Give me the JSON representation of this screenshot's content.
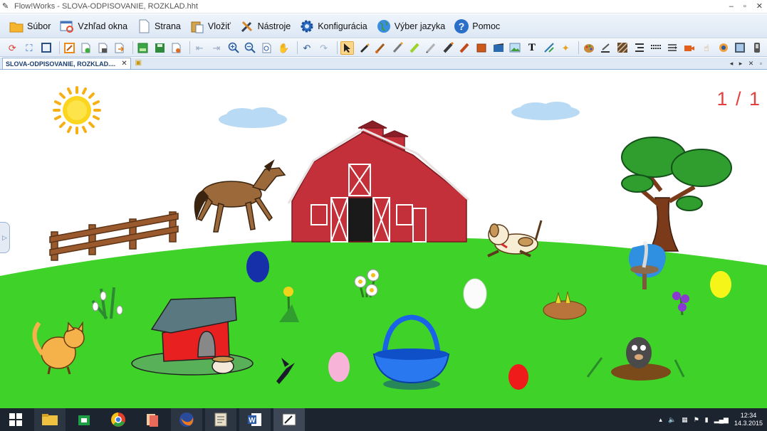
{
  "window": {
    "title": "Flow!Works - SLOVA-ODPISOVANIE, ROZKLAD.hht",
    "controls": [
      "–",
      "▫",
      "✕"
    ]
  },
  "menu": {
    "items": [
      {
        "label": "Súbor",
        "icon": "folder-icon"
      },
      {
        "label": "Vzhľad okna",
        "icon": "window-refresh-icon"
      },
      {
        "label": "Strana",
        "icon": "page-icon"
      },
      {
        "label": "Vložiť",
        "icon": "paste-icon"
      },
      {
        "label": "Nástroje",
        "icon": "tools-icon"
      },
      {
        "label": "Konfigurácia",
        "icon": "gear-icon"
      },
      {
        "label": "Výber jazyka",
        "icon": "globe-icon"
      },
      {
        "label": "Pomoc",
        "icon": "help-icon"
      }
    ]
  },
  "toolbar": {
    "tools": [
      "refresh-icon",
      "fullscreen-icon",
      "frame-icon",
      "edit-page-icon",
      "add-page-icon",
      "delete-page-icon",
      "export-page-icon",
      "image-green-icon",
      "save-page-icon",
      "pdf-icon",
      "prev-page-icon",
      "next-page-icon",
      "zoom-in-icon",
      "zoom-out-icon",
      "zoom-page-icon",
      "pan-hand-icon",
      "undo-icon",
      "redo-icon",
      "select-arrow-icon",
      "pen-icon",
      "brush-icon",
      "calligraphy-icon",
      "highlighter-icon",
      "pencil-icon",
      "marker-icon",
      "eraser-icon",
      "fill-icon",
      "video-clip-icon",
      "image-icon",
      "text-icon",
      "measure-icon",
      "magic-icon",
      "palette-icon",
      "color-picker-icon",
      "hatch-icon",
      "line-style-icon",
      "dash-style-icon",
      "arrow-style-icon",
      "camera-icon",
      "hand-pointer-icon",
      "spotlight-icon",
      "screen-capture-icon",
      "device-icon"
    ],
    "selected_tool": "select-arrow-icon"
  },
  "tabs": {
    "document_tab": "SLOVA-ODPISOVANIE, ROZKLAD....",
    "close": "✕",
    "controls": "◂ ▸ ✕ ▫"
  },
  "canvas": {
    "page_counter": "1 / 1",
    "scene_items": [
      "sun",
      "cloud",
      "cloud",
      "barn",
      "horse",
      "fence",
      "tree",
      "dog",
      "stork-nest",
      "blue-egg",
      "flowers-daisy",
      "white-egg",
      "bird-nest",
      "yellow-egg",
      "violets",
      "snowdrops",
      "dandelion",
      "doghouse",
      "cat",
      "pink-egg",
      "swallow",
      "blue-basket",
      "red-egg",
      "mole"
    ],
    "colors": {
      "grass": "#3fd32a",
      "barn": "#c4303a",
      "sun": "#fbd21a",
      "sky_cloud": "#b8daf5"
    }
  },
  "taskbar": {
    "apps": [
      "windows-start-icon",
      "file-explorer-icon",
      "store-icon",
      "chrome-icon",
      "documents-icon",
      "firefox-icon",
      "notes-app-icon",
      "word-icon",
      "flowworks-icon"
    ],
    "active": "flowworks-icon",
    "clock_time": "12:34",
    "clock_date": "14.3.2015"
  }
}
